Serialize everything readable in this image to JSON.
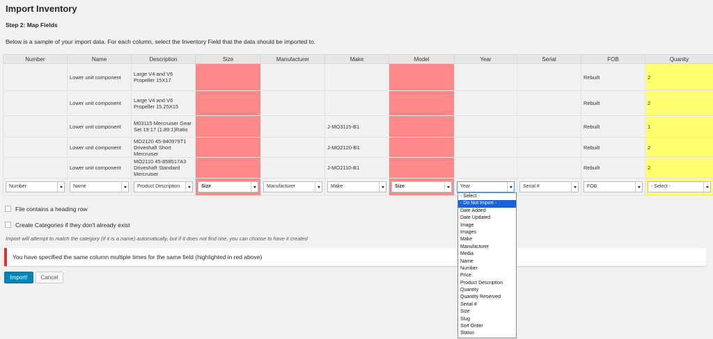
{
  "page": {
    "title": "Import Inventory",
    "step": "Step 2: Map Fields",
    "intro": "Below is a sample of your import data. For each column, select the Inventory Field that the data should be imported to."
  },
  "columns": [
    "Number",
    "Name",
    "Description",
    "Size",
    "Manufacturer",
    "Make",
    "Model",
    "Year",
    "Serial",
    "FOB",
    "Quanity"
  ],
  "rows": [
    [
      "",
      "Lower unit component",
      "Large V4 and V6 Propeller 15X17",
      "",
      "",
      "",
      "",
      "",
      "",
      "Rebuilt",
      "2"
    ],
    [
      "",
      "Lower unit component",
      "Large V4 and V6 Propeller 15.25X15",
      "",
      "",
      "",
      "",
      "",
      "",
      "Rebuilt",
      "2"
    ],
    [
      "",
      "Lower unit component",
      "M03115 Mercruiser Gear Set 19:17 (1.89:1)Ratio",
      "",
      "",
      "J-MO3115-B1",
      "",
      "",
      "",
      "Rebuilt",
      "1"
    ],
    [
      "",
      "Lower unit component",
      "MO2120 45-840979T1 Driveshaft Short Mercruiser",
      "",
      "",
      "J-MO2120-B1",
      "",
      "",
      "",
      "Rebuilt",
      "2"
    ],
    [
      "",
      "Lower unit component",
      "MO2110 45-858517A3 Driveshaft Standard Mercruiser",
      "",
      "",
      "J-MO2110-B1",
      "",
      "",
      "",
      "Rebuilt",
      "2"
    ]
  ],
  "selects": [
    "Number",
    "Name",
    "Product Description",
    "Size",
    "Manufacturer",
    "Make",
    "Size",
    "Year",
    "Serial #",
    "FOB",
    "- Select -"
  ],
  "options": {
    "heading_row": "File contains a heading row",
    "create_categories": "Create Categories if they don't already exist"
  },
  "note": "Import will attempt to match the category (if it is a name) automatically, but if it does not find one, you can choose to have it created",
  "error": "You have specified the same column multiple times for the same field (highlighted in red above)",
  "buttons": {
    "import": "Import!",
    "cancel": "Cancel"
  },
  "dropdown": [
    "- Select -",
    "- Do Not Import -",
    "Date Added",
    "Date Updated",
    "Image",
    "Images",
    "Make",
    "Manufacturer",
    "Media",
    "Name",
    "Number",
    "Price",
    "Product Description",
    "Quantity",
    "Quantity Reserved",
    "Serial #",
    "Size",
    "Slug",
    "Sort Order",
    "Status"
  ],
  "colors": {
    "duplicate": "#ff8888",
    "unmapped": "#ffff70",
    "primary": "#0085ba",
    "error": "#dc3232"
  }
}
